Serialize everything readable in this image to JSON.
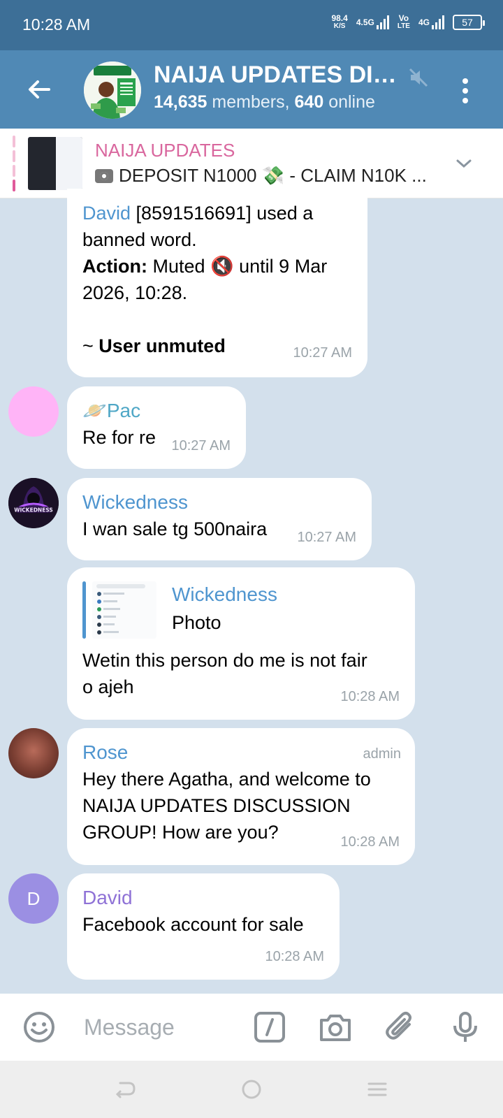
{
  "status_bar": {
    "time": "10:28 AM",
    "speed_value": "98.4",
    "speed_unit": "K/S",
    "net1": "4.5G",
    "volte_top": "Vo",
    "volte_bottom": "LTE",
    "net2": "4G",
    "battery": "57"
  },
  "header": {
    "title": "NAIJA UPDATES DIS...",
    "members_count": "14,635",
    "members_text": "members,",
    "online_count": "640",
    "online_text": "online"
  },
  "pinned": {
    "title": "NAIJA UPDATES",
    "text": "DEPOSIT N1000 💸 - CLAIM N10K ..."
  },
  "messages": [
    {
      "mention": "David",
      "line1_rest": " [8591516691] used a",
      "line2": "banned word.",
      "action_label": "Action:",
      "action_text": " Muted 🔇 until 9 Mar",
      "line4": "2026, 10:28.",
      "unmute_prefix": "~ ",
      "unmute_text": "User unmuted",
      "time": "10:27 AM"
    },
    {
      "sender_emoji": "🪐",
      "sender": "Pac",
      "text": "Re for re",
      "time": "10:27 AM",
      "avatar_color": "#ffb4f7"
    },
    {
      "sender": "Wickedness",
      "text": "I wan sale tg 500naira",
      "time": "10:27 AM",
      "avatar_label": "WICKEDNESS"
    },
    {
      "reply_sender": "Wickedness",
      "reply_text": "Photo",
      "line1": "Wetin this person do me is not fair",
      "line2": "o ajeh",
      "time": "10:28 AM"
    },
    {
      "sender": "Rose",
      "badge": "admin",
      "line1": "Hey there Agatha, and welcome to",
      "line2": "NAIJA UPDATES DISCUSSION",
      "line3": "GROUP! How are you?",
      "time": "10:28 AM"
    },
    {
      "sender": "David",
      "avatar_letter": "D",
      "text": "Facebook account for sale",
      "time": "10:28 AM",
      "avatar_color": "#9b8fe3"
    }
  ],
  "input": {
    "placeholder": "Message"
  },
  "colors": {
    "header": "#5089b5",
    "status_bar": "#3d6f97",
    "chat_bg": "#d3e0ec",
    "pinned_title": "#d9679e",
    "link_blue": "#4f95cf"
  }
}
